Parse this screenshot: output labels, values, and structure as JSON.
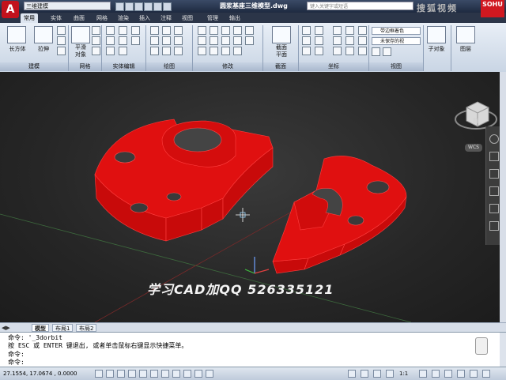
{
  "titlebar": {
    "workspace": "三维建模",
    "document": "圆浆基座三维模型.dwg",
    "search_placeholder": "键入关键字或短语",
    "brand": "搜狐视频"
  },
  "tabs": [
    "常用",
    "实体",
    "曲面",
    "网格",
    "渲染",
    "插入",
    "注释",
    "视图",
    "管理",
    "输出"
  ],
  "ribbon": {
    "groups": [
      "建模",
      "网格",
      "实体编辑",
      "绘图",
      "修改",
      "截面",
      "坐标",
      "视图"
    ],
    "big_buttons": {
      "box": "长方体",
      "extrude": "拉伸",
      "smooth": "平滑\n对象",
      "section": "截面\n平面",
      "subobject": "子对象",
      "layers": "图层"
    },
    "view_dropdowns": [
      "带边框着色",
      "未保存的视"
    ]
  },
  "viewport": {
    "caption": "学习CAD加QQ 526335121",
    "wcs_label": "WCS",
    "cube_face": "前"
  },
  "layout_tabs": [
    "模型",
    "布局1",
    "布局2"
  ],
  "command": {
    "line1": "命令: '_3dorbit",
    "line2": "按 ESC 或 ENTER 键退出, 或者单击鼠标右键显示快捷菜单。",
    "line3": "命令:",
    "line4": "命令:"
  },
  "status": {
    "coords": "27.1554, 17.0674 , 0.0000",
    "scale": "1:1"
  },
  "colors": {
    "model": "#e01010",
    "ribbon_bg": "#dde5f0",
    "viewport_bg": "#262626"
  }
}
